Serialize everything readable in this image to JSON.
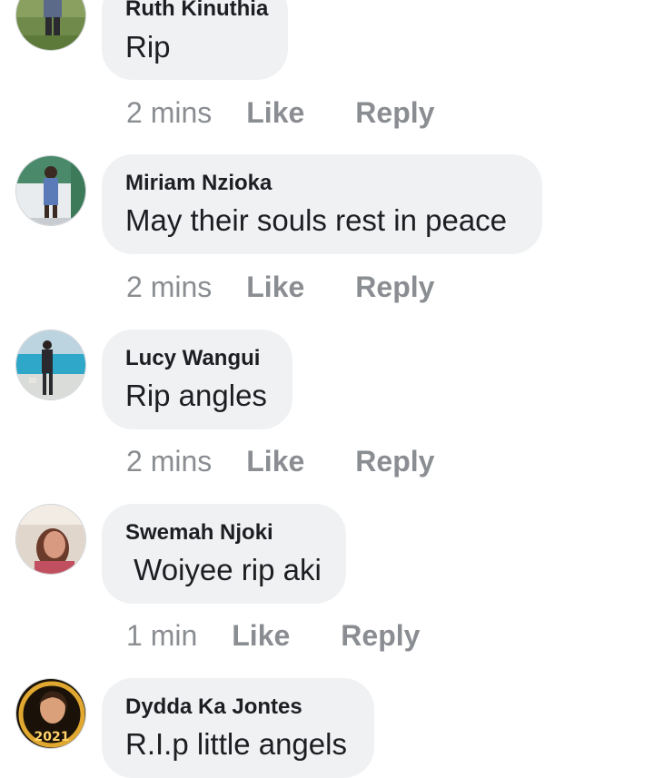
{
  "comments": [
    {
      "author": "Ruth Kinuthia",
      "text": "Rip",
      "time": "2 mins",
      "like_label": "Like",
      "reply_label": "Reply"
    },
    {
      "author": "Miriam Nzioka",
      "text": "May their souls rest in peace",
      "time": "2 mins",
      "like_label": "Like",
      "reply_label": "Reply"
    },
    {
      "author": "Lucy Wangui",
      "text": "Rip angles",
      "time": "2 mins",
      "like_label": "Like",
      "reply_label": "Reply"
    },
    {
      "author": "Swemah Njoki",
      "text": " Woiyee rip aki",
      "time": "1 min",
      "like_label": "Like",
      "reply_label": "Reply"
    },
    {
      "author": "Dydda Ka Jontes",
      "text": "R.I.p little angels",
      "time": "",
      "like_label": "",
      "reply_label": ""
    }
  ],
  "avatar_badge": "2021",
  "colors": {
    "bubble": "#eff1f3",
    "author": "#1c1e21",
    "meta": "#8a8d91"
  }
}
